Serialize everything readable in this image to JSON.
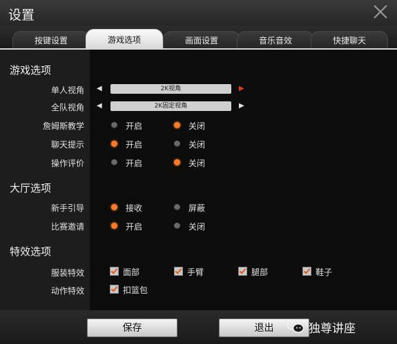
{
  "window": {
    "title": "设置"
  },
  "tabs": [
    {
      "label": "按键设置"
    },
    {
      "label": "游戏选项",
      "active": true
    },
    {
      "label": "画面设置"
    },
    {
      "label": "音乐音效"
    },
    {
      "label": "快捷聊天"
    }
  ],
  "game_options": {
    "heading": "游戏选项",
    "single_view": {
      "label": "单人视角",
      "value": "2K视角"
    },
    "team_view": {
      "label": "全队视角",
      "value": "2K固定视角"
    },
    "james_tutorial": {
      "label": "詹姆斯教学",
      "on": "开启",
      "off": "关闭",
      "selected": "off"
    },
    "chat_tips": {
      "label": "聊天提示",
      "on": "开启",
      "off": "关闭",
      "selected": "on"
    },
    "op_rating": {
      "label": "操作评价",
      "on": "开启",
      "off": "关闭",
      "selected": "off"
    }
  },
  "lobby_options": {
    "heading": "大厅选项",
    "newbie_guide": {
      "label": "新手引导",
      "a": "接收",
      "b": "屏蔽",
      "selected": "a"
    },
    "match_invite": {
      "label": "比赛邀请",
      "a": "开启",
      "b": "关闭",
      "selected": "a"
    }
  },
  "effects_options": {
    "heading": "特效选项",
    "outfit_fx": {
      "label": "服装特效",
      "items": [
        "面部",
        "手臂",
        "腿部",
        "鞋子"
      ]
    },
    "action_fx": {
      "label": "动作特效",
      "items": [
        "扣篮包"
      ]
    }
  },
  "buttons": {
    "save": "保存",
    "exit": "退出"
  },
  "watermark": {
    "text": "独尊讲座"
  },
  "colors": {
    "accent": "#ff7a2a",
    "arrow_active": "#e03a1e"
  }
}
